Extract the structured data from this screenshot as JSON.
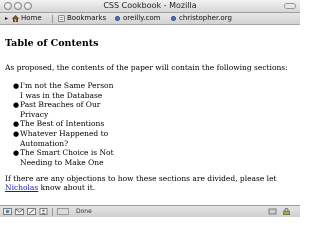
{
  "window": {
    "title": "CSS Cookbook - Mozilla"
  },
  "bookmarks_bar": {
    "toggle_icon": "disclosure-triangle-icon",
    "items": [
      {
        "label": "Home",
        "icon": "house-icon"
      },
      {
        "label": "Bookmarks",
        "icon": "bookmarks-icon"
      },
      {
        "label": "oreilly.com",
        "icon": "link-icon"
      },
      {
        "label": "christopher.org",
        "icon": "link-icon"
      }
    ]
  },
  "content": {
    "heading": "Table of Contents",
    "intro": "As proposed, the contents of the paper will contain the following sections:",
    "sections": [
      "I'm not the Same Person I was in the Database",
      "Past Breaches of Our Privacy",
      "The Best of Intentions",
      "Whatever Happened to Automation?",
      "The Smart Choice is Not Needing to Make One"
    ],
    "closing_before_link": "If there are any objections to how these sections are divided, please let ",
    "author_link": "Nicholas",
    "closing_after_link": " know about it."
  },
  "statusbar": {
    "status": "Done",
    "icons": [
      "navigator-icon",
      "mail-icon",
      "composer-icon",
      "address-book-icon",
      "security-lock-icon"
    ]
  },
  "colors": {
    "link": "#1a1ab8",
    "chrome": "#d6d6d6"
  }
}
